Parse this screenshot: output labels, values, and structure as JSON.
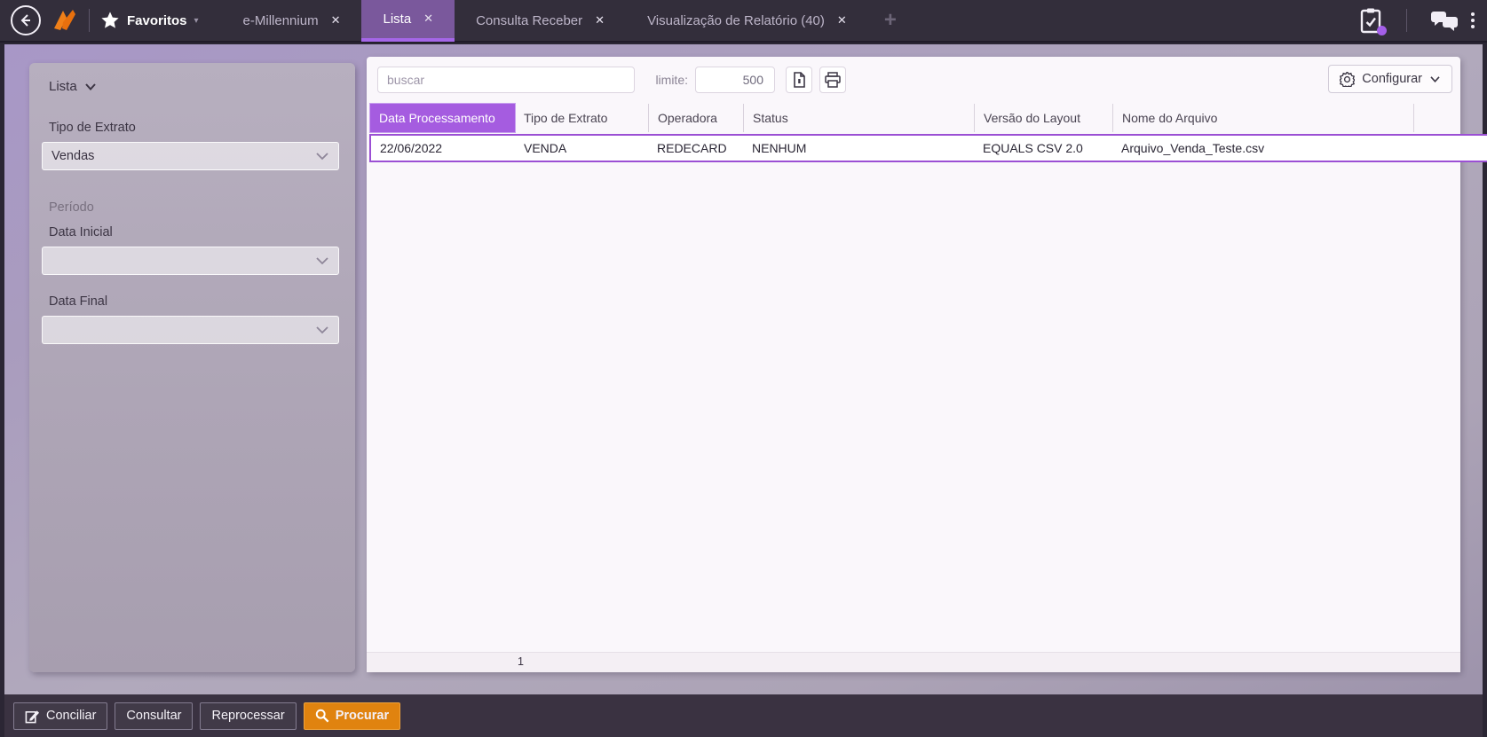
{
  "topbar": {
    "favorites_label": "Favoritos",
    "tabs": [
      {
        "label": "e-Millennium"
      },
      {
        "label": "Lista"
      },
      {
        "label": "Consulta Receber"
      },
      {
        "label": "Visualização de Relatório (40)"
      }
    ],
    "close_glyph": "✕",
    "plus_glyph": "+"
  },
  "icons": {
    "back": "back-arrow-circle",
    "logo": "millennium-orange-arrow",
    "favorites": "star",
    "notifications": "clipboard-check (purple dot badge)",
    "messages": "chat-bubbles",
    "menu": "kebab-vertical",
    "export": "document",
    "print": "printer",
    "configure": "gear",
    "conciliar": "edit-pencil",
    "procurar": "magnifier"
  },
  "sidebar": {
    "title": "Lista",
    "tipo_extrato_label": "Tipo de Extrato",
    "tipo_extrato_value": "Vendas",
    "periodo_label": "Período",
    "data_inicial_label": "Data Inicial",
    "data_inicial_value": "",
    "data_final_label": "Data Final",
    "data_final_value": ""
  },
  "toolbar": {
    "search_placeholder": "buscar",
    "limit_label": "limite:",
    "limit_value": "500",
    "configure_label": "Configurar"
  },
  "table": {
    "columns": [
      "Data Processamento",
      "Tipo de Extrato",
      "Operadora",
      "Status",
      "Versão do Layout",
      "Nome do Arquivo"
    ],
    "rows": [
      [
        "22/06/2022",
        "VENDA",
        "REDECARD",
        "NENHUM",
        "EQUALS CSV 2.0",
        "Arquivo_Venda_Teste.csv"
      ]
    ],
    "selected_row_index": 0,
    "highlighted_column": "Data Processamento",
    "page": "1"
  },
  "footer_actions": {
    "conciliar": "Conciliar",
    "consultar": "Consultar",
    "reprocessar": "Reprocessar",
    "procurar": "Procurar"
  },
  "colors": {
    "topbar_bg": "#332e3b",
    "active_tab_bg": "#7a589c",
    "active_tab_underline": "#a566e8",
    "header_highlight": "#a55ce0",
    "row_selection_border": "#9b4fd4",
    "primary_button_orange": "#e0830f",
    "desktop_purple": "#a897c7",
    "badge_purple": "#a45fe8"
  }
}
